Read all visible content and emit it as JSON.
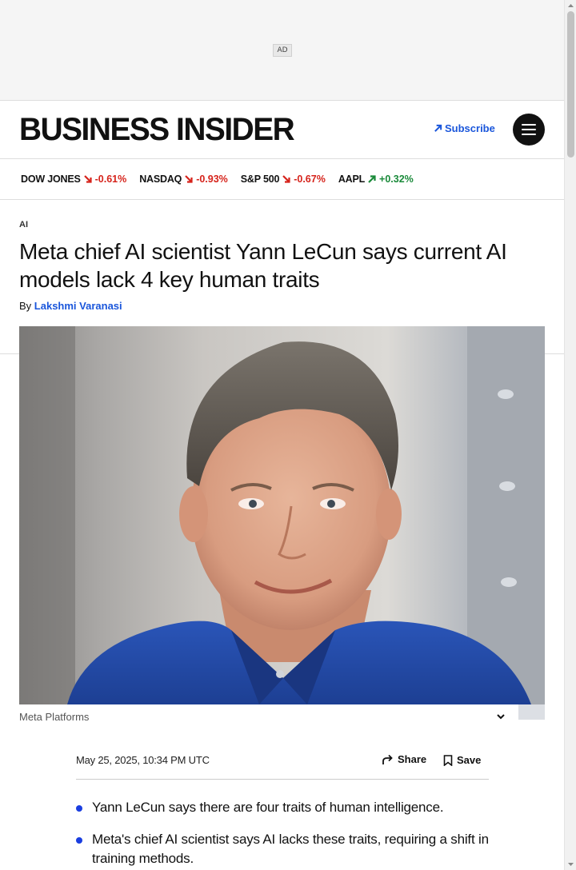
{
  "ad": {
    "label": "AD"
  },
  "header": {
    "logo_text": "BUSINESS INSIDER",
    "subscribe_label": "Subscribe",
    "menu_icon": "hamburger-icon"
  },
  "ticker": [
    {
      "symbol": "DOW JONES",
      "change": "-0.61%",
      "direction": "down"
    },
    {
      "symbol": "NASDAQ",
      "change": "-0.93%",
      "direction": "down"
    },
    {
      "symbol": "S&P 500",
      "change": "-0.67%",
      "direction": "down"
    },
    {
      "symbol": "AAPL",
      "change": "+0.32%",
      "direction": "up"
    }
  ],
  "article": {
    "category": "AI",
    "headline": "Meta chief AI scientist Yann LeCun says current AI models lack 4 key human traits",
    "by_prefix": "By",
    "author": "Lakshmi Varanasi",
    "image_caption": "Meta Platforms",
    "date": "May 25, 2025, 10:34 PM UTC",
    "share_label": "Share",
    "save_label": "Save",
    "bullets": [
      "Yann LeCun says there are four traits of human intelligence.",
      "Meta's chief AI scientist says AI lacks these traits, requiring a shift in training methods."
    ]
  },
  "colors": {
    "accent_blue": "#1a56db",
    "down_red": "#d6231b",
    "up_green": "#1a8a3a",
    "bullet_blue": "#1a3ee0"
  }
}
